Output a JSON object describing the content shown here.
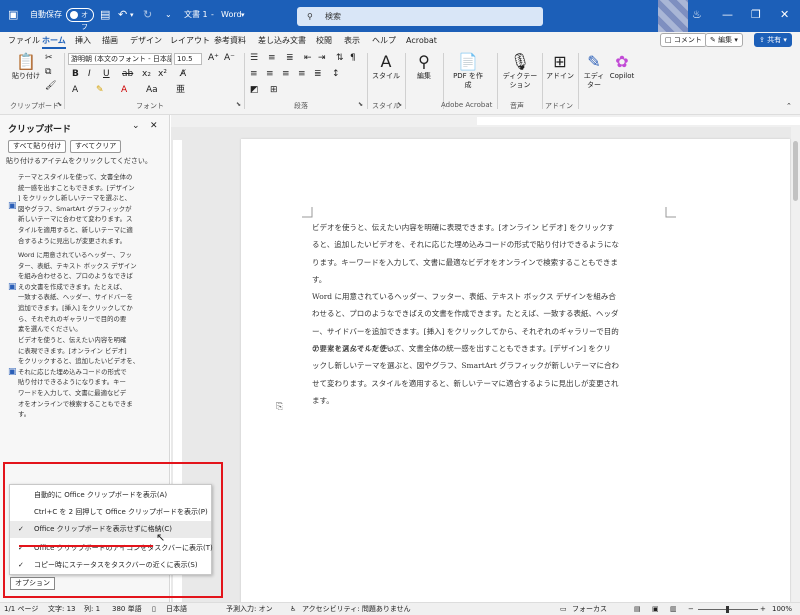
{
  "titlebar": {
    "autosave_label": "自動保存",
    "autosave_state": "オフ",
    "doc_title": "文書 1",
    "app_name": "Word",
    "search_placeholder": "検索"
  },
  "menu": {
    "items": [
      "ファイル",
      "ホーム",
      "挿入",
      "描画",
      "デザイン",
      "レイアウト",
      "参考資料",
      "差し込み文書",
      "校閲",
      "表示",
      "ヘルプ",
      "Acrobat"
    ],
    "active": "ホーム",
    "comment": "コメント",
    "edit": "編集",
    "share": "共有"
  },
  "ribbon": {
    "paste": "貼り付け",
    "font_name": "游明朝 (本文のフォント - 日本語)",
    "font_size": "10.5",
    "style": "スタイル",
    "edit": "編集",
    "pdf": "PDF を作成",
    "dictation": "ディクテーション",
    "addin": "アドイン",
    "editor": "エディター",
    "copilot": "Copilot",
    "groups": {
      "clipboard": "クリップボード",
      "font": "フォント",
      "paragraph": "段落",
      "style": "スタイル",
      "acrobat": "Adobe Acrobat",
      "voice": "音声",
      "addin": "アドイン"
    }
  },
  "clipboard_pane": {
    "title": "クリップボード",
    "paste_all": "すべて貼り付け",
    "clear_all": "すべてクリア",
    "hint": "貼り付けるアイテムをクリックしてください。",
    "items": [
      {
        "lines": [
          "テーマとスタイルを使って、文書全体の",
          "統一感を出すこともできます。[デザイン",
          "] をクリックし新しいテーマを選ぶと、",
          "図やグラフ、SmartArt グラフィックが",
          "新しいテーマに合わせて変わります。ス",
          "タイルを適用すると、新しいテーマに適",
          "合するように見出しが変更されます。"
        ]
      },
      {
        "lines": [
          "Word に用意されているヘッダー、フッ",
          "ター、表紙、テキスト ボックス デザイン",
          "を組み合わせると、プロのようなできば",
          "えの文書を作成できます。たとえば、",
          "一致する表紙、ヘッダー、サイドバーを",
          "追加できます。[挿入] をクリックしてか",
          "ら、それぞれのギャラリーで目的の要",
          "素を選んでください。"
        ]
      },
      {
        "lines": [
          "ビデオを使うと、伝えたい内容を明確",
          "に表現できます。[オンライン ビデオ]",
          "をクリックすると、追加したいビデオを、",
          "それに応じた埋め込みコードの形式で",
          "貼り付けできるようになります。キー",
          "ワードを入力して、文書に最適なビデ",
          "オをオンラインで検索することもできま",
          "す。"
        ]
      }
    ],
    "options_button": "オプション"
  },
  "options_menu": {
    "items": [
      {
        "label": "自動的に Office クリップボードを表示(A)",
        "checked": false
      },
      {
        "label": "Ctrl+C を 2 回押して Office クリップボードを表示(P)",
        "checked": false
      },
      {
        "label": "Office クリップボードを表示せずに格納(C)",
        "checked": true
      },
      {
        "label": "Office クリップボードのアイコンをタスクバーに表示(T)",
        "checked": true
      },
      {
        "label": "コピー時にステータスをタスクバーの近くに表示(S)",
        "checked": true
      }
    ]
  },
  "document": {
    "paragraphs": [
      [
        "ビデオを使うと、伝えたい内容を明確に表現できます。[オンライン ビデオ] をクリックす",
        "ると、追加したいビデオを、それに応じた埋め込みコードの形式で貼り付けできるようにな",
        "ります。キーワードを入力して、文書に最適なビデオをオンラインで検索することもできま",
        "す。"
      ],
      [
        "Word に用意されているヘッダー、フッター、表紙、テキスト ボックス デザインを組み合",
        "わせると、プロのようなできばえの文書を作成できます。たとえば、一致する表紙、ヘッダ",
        "ー、サイドバーを追加できます。[挿入] をクリックしてから、それぞれのギャラリーで目的",
        "の要素を選んでください。"
      ],
      [
        "テーマとスタイルを使って、文書全体の統一感を出すこともできます。[デザイン] をクリ",
        "ックし新しいテーマを選ぶと、図やグラフ、SmartArt グラフィックが新しいテーマに合わ",
        "せて変わります。スタイルを適用すると、新しいテーマに適合するように見出しが変更され",
        "ます。"
      ]
    ]
  },
  "statusbar": {
    "page": "1/1 ページ",
    "words": "文字: 13",
    "col": "列: 1",
    "chars": "380 単語",
    "language": "日本語",
    "predictive": "予測入力: オン",
    "accessibility": "アクセシビリティ: 問題ありません",
    "focus": "フォーカス",
    "zoom": "100%"
  },
  "colors": {
    "titlebar": "#1c5fb8",
    "highlight_box": "#e3141b"
  }
}
